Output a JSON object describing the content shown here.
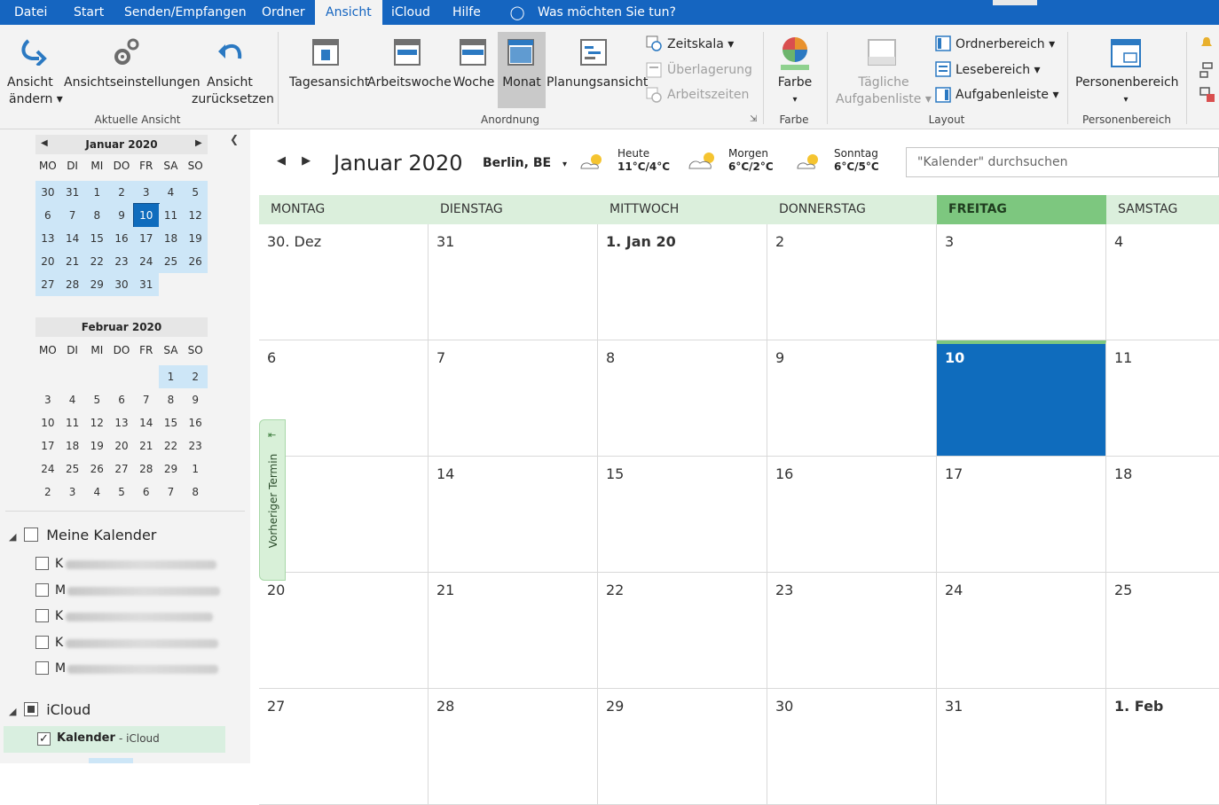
{
  "menu": {
    "items": [
      "Datei",
      "Start",
      "Senden/Empfangen",
      "Ordner",
      "Ansicht",
      "iCloud",
      "Hilfe"
    ],
    "active": "Ansicht",
    "tell_me": "Was möchten Sie tun?"
  },
  "ribbon": {
    "current_view": {
      "change_view": [
        "Ansicht",
        "ändern ▾"
      ],
      "view_settings": "Ansichtseinstellungen",
      "reset_view": [
        "Ansicht",
        "zurücksetzen"
      ],
      "group_label": "Aktuelle Ansicht"
    },
    "arrangement": {
      "day": "Tagesansicht",
      "work_week": "Arbeitswoche",
      "week": "Woche",
      "month": "Monat",
      "schedule": "Planungsansicht",
      "timescale": "Zeitskala ▾",
      "overlay": "Überlagerung",
      "work_hours": "Arbeitszeiten",
      "group_label": "Anordnung"
    },
    "color": {
      "label": "Farbe",
      "arrow": "▾",
      "group_label": "Farbe"
    },
    "layout": {
      "daily_task_list": [
        "Tägliche",
        "Aufgabenliste ▾"
      ],
      "folder_pane": "Ordnerbereich ▾",
      "reading_pane": "Lesebereich ▾",
      "todo_bar": "Aufgabenleiste ▾",
      "group_label": "Layout"
    },
    "people": {
      "label": "Personenbereich",
      "arrow": "▾",
      "group_label": "Personenbereich"
    }
  },
  "mini_calendars": [
    {
      "title": "Januar 2020",
      "weekdays": [
        "MO",
        "DI",
        "MI",
        "DO",
        "FR",
        "SA",
        "SO"
      ],
      "weeks": [
        [
          "30",
          "31",
          "1",
          "2",
          "3",
          "4",
          "5"
        ],
        [
          "6",
          "7",
          "8",
          "9",
          "10",
          "11",
          "12"
        ],
        [
          "13",
          "14",
          "15",
          "16",
          "17",
          "18",
          "19"
        ],
        [
          "20",
          "21",
          "22",
          "23",
          "24",
          "25",
          "26"
        ],
        [
          "27",
          "28",
          "29",
          "30",
          "31",
          "",
          ""
        ]
      ]
    },
    {
      "title": "Februar 2020",
      "weekdays": [
        "MO",
        "DI",
        "MI",
        "DO",
        "FR",
        "SA",
        "SO"
      ],
      "weeks": [
        [
          "",
          "",
          "",
          "",
          "",
          "1",
          "2"
        ],
        [
          "3",
          "4",
          "5",
          "6",
          "7",
          "8",
          "9"
        ],
        [
          "10",
          "11",
          "12",
          "13",
          "14",
          "15",
          "16"
        ],
        [
          "17",
          "18",
          "19",
          "20",
          "21",
          "22",
          "23"
        ],
        [
          "24",
          "25",
          "26",
          "27",
          "28",
          "29",
          "1"
        ],
        [
          "2",
          "3",
          "4",
          "5",
          "6",
          "7",
          "8"
        ]
      ]
    }
  ],
  "calendars": {
    "my_calendars_label": "Meine Kalender",
    "my_items_initials": [
      "K",
      "M",
      "K",
      "K",
      "M"
    ],
    "icloud_label": "iCloud",
    "icloud_item_name": "Kalender",
    "icloud_item_suffix": "- iCloud"
  },
  "main": {
    "month_title": "Januar 2020",
    "location": "Berlin, BE",
    "location_arrow": "▾",
    "weather": [
      {
        "day": "Heute",
        "temp": "11°C/4°C"
      },
      {
        "day": "Morgen",
        "temp": "6°C/2°C"
      },
      {
        "day": "Sonntag",
        "temp": "6°C/5°C"
      }
    ],
    "search_placeholder": "\"Kalender\" durchsuchen",
    "weekday_headers": [
      "MONTAG",
      "DIENSTAG",
      "MITTWOCH",
      "DONNERSTAG",
      "FREITAG",
      "SAMSTAG"
    ],
    "weeks": [
      [
        "30. Dez",
        "31",
        "1. Jan 20",
        "2",
        "3",
        "4"
      ],
      [
        "6",
        "7",
        "8",
        "9",
        "10",
        "11"
      ],
      [
        "",
        "14",
        "15",
        "16",
        "17",
        "18"
      ],
      [
        "20",
        "21",
        "22",
        "23",
        "24",
        "25"
      ],
      [
        "27",
        "28",
        "29",
        "30",
        "31",
        "1. Feb"
      ]
    ],
    "previous_appointment": "Vorheriger Termin"
  },
  "colors": {
    "accent": "#1565c0",
    "today": "#0f6cbd",
    "header_green": "#dbefdc",
    "today_header_green": "#7dc77f"
  }
}
